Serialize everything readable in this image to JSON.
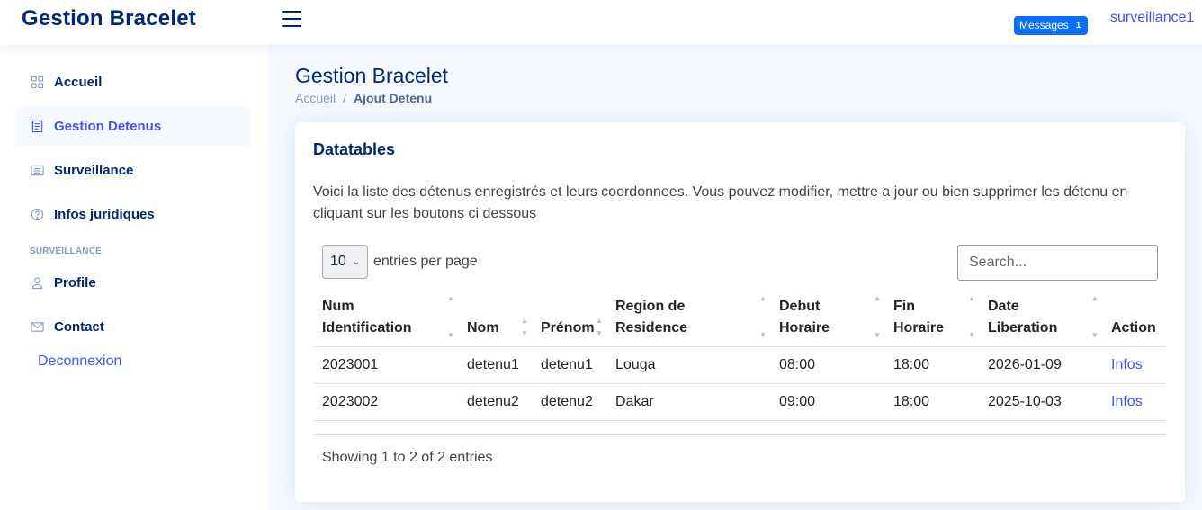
{
  "header": {
    "logo": "Gestion Bracelet",
    "messages_label": "Messages",
    "messages_count": "1",
    "user": "surveillance1"
  },
  "sidebar": {
    "items": [
      {
        "label": "Accueil",
        "icon": "grid-icon"
      },
      {
        "label": "Gestion Detenus",
        "icon": "journal-icon",
        "active": true
      },
      {
        "label": "Surveillance",
        "icon": "list-card-icon"
      },
      {
        "label": "Infos juridiques",
        "icon": "question-circle-icon"
      }
    ],
    "section_heading": "SURVEILLANCE",
    "section_items": [
      {
        "label": "Profile",
        "icon": "person-icon"
      },
      {
        "label": "Contact",
        "icon": "envelope-icon"
      }
    ],
    "logout": "Deconnexion"
  },
  "main": {
    "title": "Gestion Bracelet",
    "breadcrumb": {
      "home": "Accueil",
      "separator": "/",
      "current": "Ajout Detenu"
    },
    "card": {
      "title": "Datatables",
      "description": "Voici la liste des détenus enregistrés et leurs coordonnees. Vous pouvez modifier, mettre a jour ou bien supprimer les détenu en cliquant sur les boutons ci dessous",
      "entries_value": "10",
      "entries_label": "entries per page",
      "search_placeholder": "Search...",
      "columns": [
        {
          "line1": "Num",
          "line2": "Identification"
        },
        {
          "line1": "",
          "line2": "Nom"
        },
        {
          "line1": "",
          "line2": "Prénom"
        },
        {
          "line1": "Region de",
          "line2": "Residence"
        },
        {
          "line1": "Debut",
          "line2": "Horaire"
        },
        {
          "line1": "Fin",
          "line2": "Horaire"
        },
        {
          "line1": "Date",
          "line2": "Liberation"
        },
        {
          "line1": "",
          "line2": "Action"
        }
      ],
      "rows": [
        [
          "2023001",
          "detenu1",
          "detenu1",
          "Louga",
          "08:00",
          "18:00",
          "2026-01-09",
          "Infos"
        ],
        [
          "2023002",
          "detenu2",
          "detenu2",
          "Dakar",
          "09:00",
          "18:00",
          "2025-10-03",
          "Infos"
        ]
      ],
      "showing": "Showing 1 to 2 of 2 entries"
    }
  },
  "colors": {
    "brand": "#012970",
    "accent": "#4154f1",
    "badge": "#0d6efd",
    "background": "#f6f9ff"
  }
}
